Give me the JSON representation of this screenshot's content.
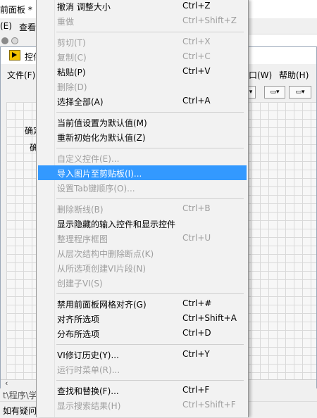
{
  "background": {
    "title_fragment": "前面板 *",
    "menubar": [
      {
        "label": "(E)",
        "x": 0
      },
      {
        "label": "查看(",
        "x": 27
      }
    ],
    "inner": {
      "title": "控件",
      "menu_left": "文件(F)",
      "menu_right": [
        {
          "label": "口(W)"
        },
        {
          "label": "帮助(H)"
        }
      ],
      "canvas_labels": [
        "确定",
        "确定"
      ],
      "bottom_text": "t\\程序\\学数",
      "status_text": "如有疑问"
    }
  },
  "menu": {
    "items": [
      {
        "label": "撤消 调整大小",
        "shortcut": "Ctrl+Z",
        "disabled": false
      },
      {
        "label": "重做",
        "shortcut": "Ctrl+Shift+Z",
        "disabled": true
      },
      {
        "sep": true
      },
      {
        "label": "剪切(T)",
        "shortcut": "Ctrl+X",
        "disabled": true
      },
      {
        "label": "复制(C)",
        "shortcut": "Ctrl+C",
        "disabled": true
      },
      {
        "label": "粘贴(P)",
        "shortcut": "Ctrl+V",
        "disabled": false
      },
      {
        "label": "删除(D)",
        "shortcut": "",
        "disabled": true
      },
      {
        "label": "选择全部(A)",
        "shortcut": "Ctrl+A",
        "disabled": false
      },
      {
        "sep": true
      },
      {
        "label": "当前值设置为默认值(M)",
        "shortcut": "",
        "disabled": false
      },
      {
        "label": "重新初始化为默认值(Z)",
        "shortcut": "",
        "disabled": false
      },
      {
        "sep": true
      },
      {
        "label": "自定义控件(E)...",
        "shortcut": "",
        "disabled": true
      },
      {
        "label": "导入图片至剪贴板(I)...",
        "shortcut": "",
        "disabled": false,
        "highlighted": true
      },
      {
        "label": "设置Tab键顺序(O)...",
        "shortcut": "",
        "disabled": true
      },
      {
        "sep": true
      },
      {
        "label": "删除断线(B)",
        "shortcut": "Ctrl+B",
        "disabled": true
      },
      {
        "label": "显示隐藏的输入控件和显示控件",
        "shortcut": "",
        "disabled": false
      },
      {
        "label": "整理程序框图",
        "shortcut": "Ctrl+U",
        "disabled": true
      },
      {
        "label": "从层次结构中删除断点(K)",
        "shortcut": "",
        "disabled": true
      },
      {
        "label": "从所选项创建VI片段(N)",
        "shortcut": "",
        "disabled": true
      },
      {
        "label": "创建子VI(S)",
        "shortcut": "",
        "disabled": true
      },
      {
        "sep": true
      },
      {
        "label": "禁用前面板网格对齐(G)",
        "shortcut": "Ctrl+#",
        "disabled": false
      },
      {
        "label": "对齐所选项",
        "shortcut": "Ctrl+Shift+A",
        "disabled": false
      },
      {
        "label": "分布所选项",
        "shortcut": "Ctrl+D",
        "disabled": false
      },
      {
        "sep": true
      },
      {
        "label": "VI修订历史(Y)...",
        "shortcut": "Ctrl+Y",
        "disabled": false
      },
      {
        "label": "运行时菜单(R)...",
        "shortcut": "",
        "disabled": true
      },
      {
        "sep": true
      },
      {
        "label": "查找和替换(F)...",
        "shortcut": "Ctrl+F",
        "disabled": false
      },
      {
        "label": "显示搜索结果(H)",
        "shortcut": "Ctrl+Shift+F",
        "disabled": true
      }
    ]
  }
}
